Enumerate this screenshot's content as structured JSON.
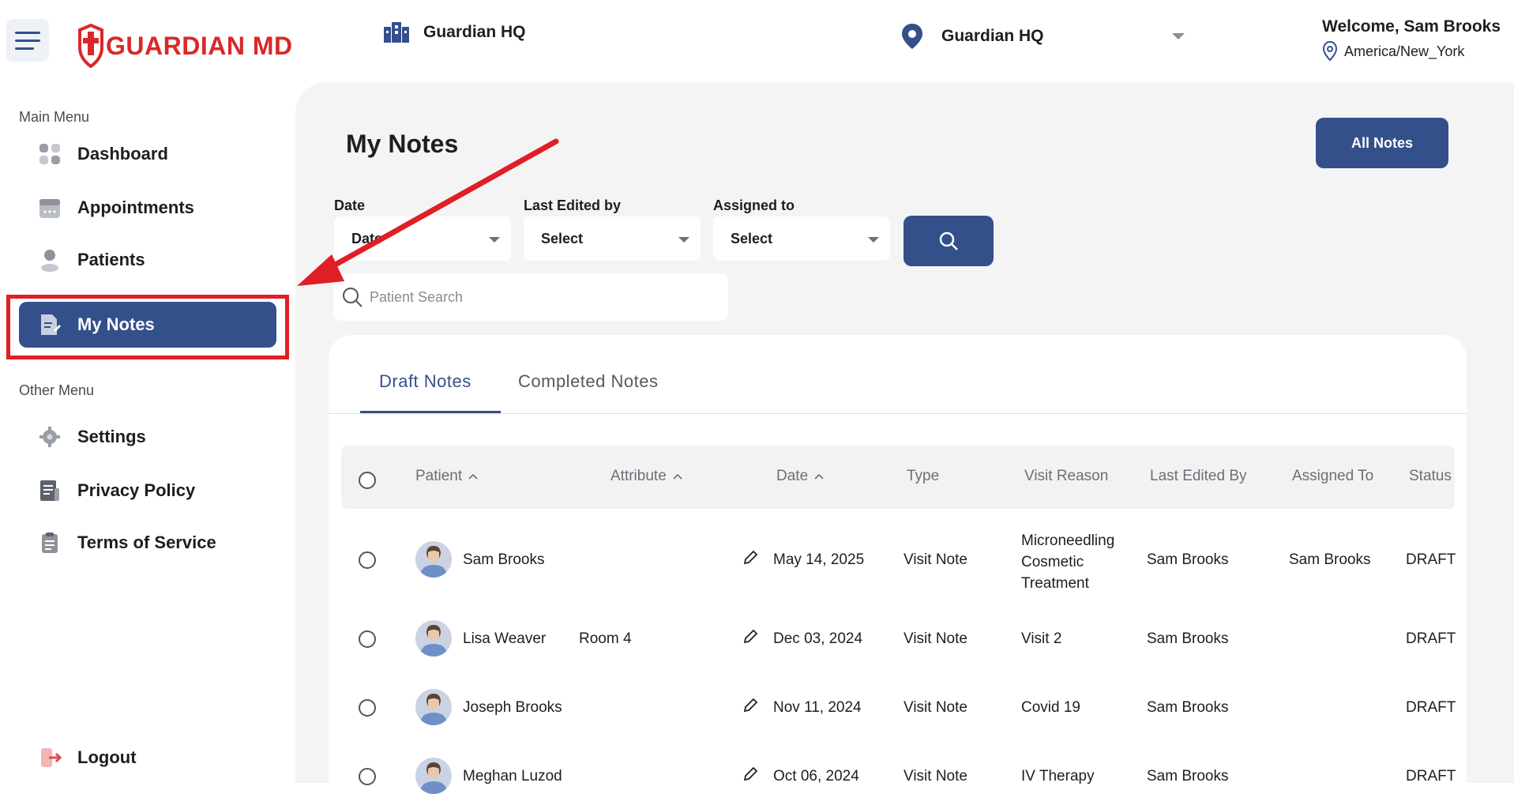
{
  "header": {
    "logo_text": "GUARDIAN MD",
    "location_left": "Guardian HQ",
    "location_select": "Guardian HQ",
    "welcome": "Welcome, Sam Brooks",
    "timezone": "America/New_York"
  },
  "sidebar": {
    "main_menu_label": "Main Menu",
    "other_menu_label": "Other Menu",
    "main_items": [
      {
        "label": "Dashboard",
        "icon": "dashboard-icon"
      },
      {
        "label": "Appointments",
        "icon": "calendar-icon"
      },
      {
        "label": "Patients",
        "icon": "user-icon"
      },
      {
        "label": "My Notes",
        "icon": "notes-icon",
        "active": true
      }
    ],
    "other_items": [
      {
        "label": "Settings",
        "icon": "gear-icon"
      },
      {
        "label": "Privacy Policy",
        "icon": "document-icon"
      },
      {
        "label": "Terms of Service",
        "icon": "clipboard-icon"
      }
    ],
    "logout": "Logout"
  },
  "main": {
    "title": "My Notes",
    "all_notes_button": "All Notes",
    "filters": {
      "date_label": "Date",
      "date_value": "Date",
      "last_edited_label": "Last Edited by",
      "last_edited_value": "Select",
      "assigned_label": "Assigned to",
      "assigned_value": "Select"
    },
    "search_placeholder": "Patient Search",
    "tabs": [
      "Draft Notes",
      "Completed Notes"
    ],
    "columns": [
      "Patient",
      "Attribute",
      "Date",
      "Type",
      "Visit Reason",
      "Last Edited By",
      "Assigned To",
      "Status"
    ],
    "rows": [
      {
        "patient": "Sam Brooks",
        "attribute": "",
        "date": "May 14, 2025",
        "type": "Visit Note",
        "visit_reason": [
          "Microneedling",
          "Cosmetic",
          "Treatment"
        ],
        "last_edited_by": "Sam Brooks",
        "assigned_to": "Sam Brooks",
        "status": "DRAFT"
      },
      {
        "patient": "Lisa Weaver",
        "attribute": "Room 4",
        "date": "Dec 03, 2024",
        "type": "Visit Note",
        "visit_reason": [
          "Visit 2"
        ],
        "last_edited_by": "Sam Brooks",
        "assigned_to": "",
        "status": "DRAFT"
      },
      {
        "patient": "Joseph Brooks",
        "attribute": "",
        "date": "Nov 11, 2024",
        "type": "Visit Note",
        "visit_reason": [
          "Covid 19"
        ],
        "last_edited_by": "Sam Brooks",
        "assigned_to": "",
        "status": "DRAFT"
      },
      {
        "patient": "Meghan Luzod",
        "attribute": "",
        "date": "Oct 06, 2024",
        "type": "Visit Note",
        "visit_reason": [
          "IV Therapy"
        ],
        "last_edited_by": "Sam Brooks",
        "assigned_to": "",
        "status": "DRAFT"
      }
    ]
  },
  "colors": {
    "accent": "#34508a",
    "brand_red": "#d92828",
    "annotation_red": "#e01e25"
  }
}
